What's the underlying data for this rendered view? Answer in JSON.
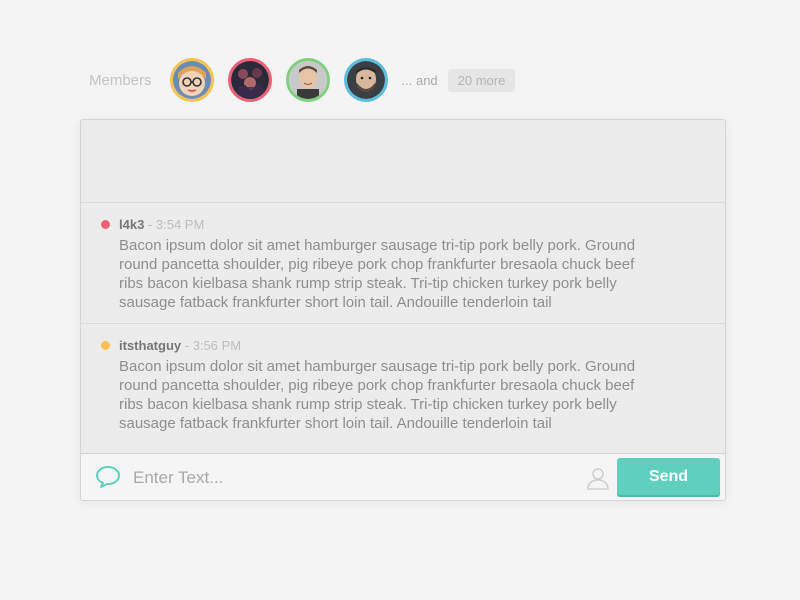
{
  "members": {
    "label": "Members",
    "avatars": [
      {
        "name": "avatar-1",
        "ring_color": "#f9c152"
      },
      {
        "name": "avatar-2",
        "ring_color": "#ee6073"
      },
      {
        "name": "avatar-3",
        "ring_color": "#7fcf7e"
      },
      {
        "name": "avatar-4",
        "ring_color": "#5bbedf"
      }
    ],
    "and_text": "... and",
    "more_count": "20 more"
  },
  "messages": [
    {
      "user": "l4k3",
      "time": "- 3:54 PM",
      "dot_color": "#ee6073",
      "body": "Bacon ipsum dolor sit amet hamburger sausage tri-tip pork belly pork. Ground round pancetta shoulder, pig ribeye pork chop frankfurter bresaola chuck beef ribs bacon kielbasa shank rump strip steak. Tri-tip chicken turkey pork belly sausage fatback frankfurter short loin tail. Andouille tenderloin tail"
    },
    {
      "user": "itsthatguy",
      "time": "- 3:56 PM",
      "dot_color": "#f9c152",
      "body": "Bacon ipsum dolor sit amet hamburger sausage tri-tip pork belly pork. Ground round pancetta shoulder, pig ribeye pork chop frankfurter bresaola chuck beef ribs bacon kielbasa shank rump strip steak. Tri-tip chicken turkey pork belly sausage fatback frankfurter short loin tail. Andouille tenderloin tail"
    }
  ],
  "composer": {
    "placeholder": "Enter Text...",
    "send_label": "Send",
    "chat_icon": "speech-bubble-icon",
    "user_icon": "user-icon"
  },
  "colors": {
    "accent": "#5fd0bd",
    "background": "#f4f4f4"
  }
}
